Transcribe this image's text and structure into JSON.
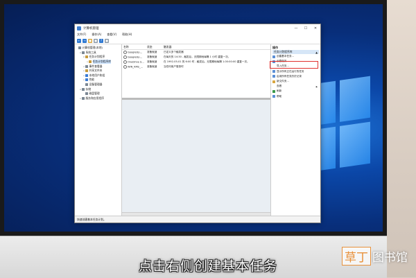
{
  "window": {
    "title": "计算机管理",
    "controls": [
      "—",
      "☐",
      "✕"
    ]
  },
  "menu": [
    "文件(F)",
    "操作(A)",
    "查看(V)",
    "帮助(H)"
  ],
  "toolbar": [
    "←",
    "→",
    "■",
    "■",
    "?",
    "■"
  ],
  "tree": [
    {
      "label": "计算机管理(本地)",
      "level": 0,
      "arrow": "",
      "icon": "gray"
    },
    {
      "label": "系统工具",
      "level": 1,
      "arrow": "∨",
      "icon": "gray"
    },
    {
      "label": "任务计划程序",
      "level": 2,
      "arrow": "∨",
      "icon": "gold"
    },
    {
      "label": "任务计划程序库",
      "level": 3,
      "arrow": ">",
      "icon": "gold",
      "selected": true
    },
    {
      "label": "事件查看器",
      "level": 2,
      "arrow": ">",
      "icon": "gray"
    },
    {
      "label": "共享文件夹",
      "level": 2,
      "arrow": ">",
      "icon": "gold"
    },
    {
      "label": "本地用户和组",
      "level": 2,
      "arrow": ">",
      "icon": "blue"
    },
    {
      "label": "性能",
      "level": 2,
      "arrow": ">",
      "icon": "blue"
    },
    {
      "label": "设备管理器",
      "level": 2,
      "arrow": "",
      "icon": "gray"
    },
    {
      "label": "存储",
      "level": 1,
      "arrow": "∨",
      "icon": "gray"
    },
    {
      "label": "磁盘管理",
      "level": 2,
      "arrow": "",
      "icon": "gray"
    },
    {
      "label": "服务和应用程序",
      "level": 1,
      "arrow": ">",
      "icon": "gray"
    }
  ],
  "task_table": {
    "headers": [
      "名称",
      "状态",
      "触发器"
    ],
    "rows": [
      [
        "GoogleUp...",
        "准备就绪",
        "已定义多个触发器"
      ],
      [
        "GoogleUp...",
        "准备就绪",
        "在每天的 14:30 - 触发后，无限期地每隔 1 小时 重复一次。"
      ],
      [
        "OneDrive S...",
        "准备就绪",
        "在 1992-05-01 的 6:00 时 - 触发后，无限期地每隔 1.00:00:00 重复一次。"
      ],
      [
        "WIN_KMS_...",
        "准备就绪",
        "当任何用户登录时"
      ]
    ]
  },
  "actions": {
    "header": "操作",
    "section": "任务计划程序库",
    "section_caret": "▲",
    "items": [
      {
        "label": "创建基本任务...",
        "icon": "blue"
      },
      {
        "label": "创建任务...",
        "icon": "blue"
      },
      {
        "label": "导入任务...",
        "icon": ""
      },
      {
        "label": "显示所有正在运行的任务",
        "icon": "blue"
      },
      {
        "label": "启用所有任务历史记录",
        "icon": "blue"
      },
      {
        "label": "新文件夹...",
        "icon": "gold"
      },
      {
        "label": "查看",
        "icon": "",
        "caret": "▶"
      },
      {
        "label": "刷新",
        "icon": "green"
      },
      {
        "label": "帮助",
        "icon": "blue"
      }
    ]
  },
  "status_text": "快速创建基本任务计划。",
  "subtitle": "点击右侧创建基本任务",
  "watermark": {
    "boxed": "草丁",
    "rest": "图书馆"
  },
  "colors": {
    "highlight": "#e0312e",
    "watermark": "#e8913b"
  }
}
